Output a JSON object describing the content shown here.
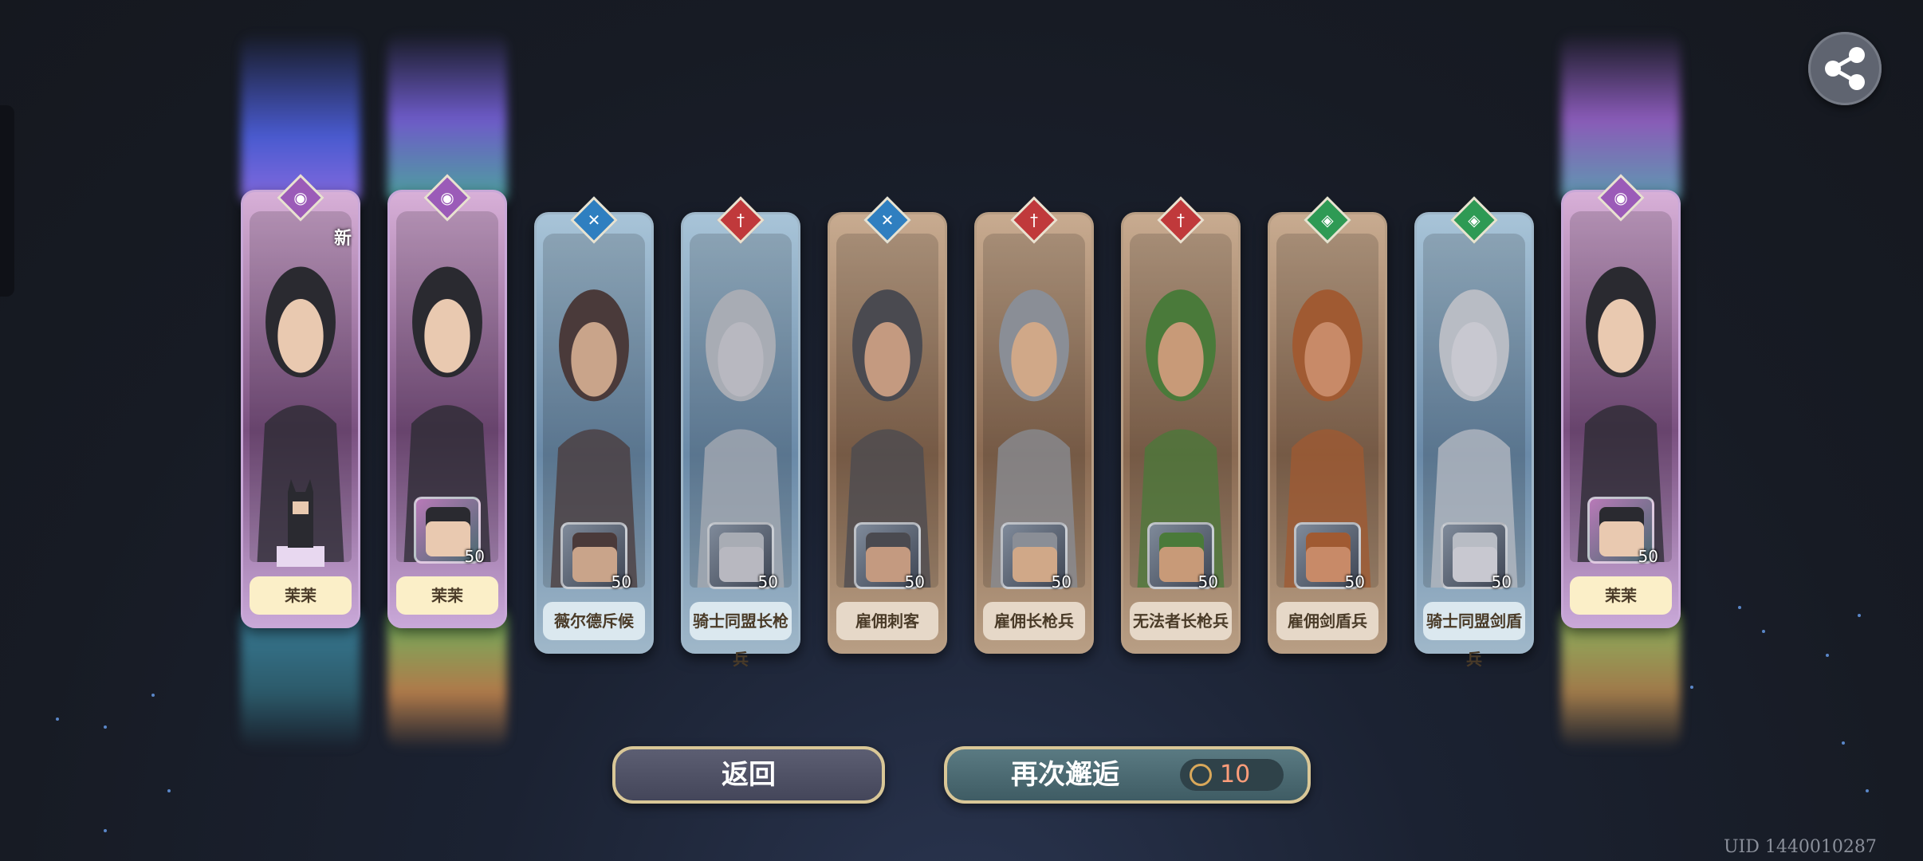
{
  "cards": [
    {
      "name": "茉茉",
      "rarity": "ssr",
      "badge_color": "#9b5bb8",
      "badge_icon": "vortex-icon",
      "frame_color": "#c9a8d8",
      "is_new": true,
      "new_label": "新",
      "reward": "sprite"
    },
    {
      "name": "茉茉",
      "rarity": "ssr",
      "badge_color": "#9b5bb8",
      "badge_icon": "vortex-icon",
      "frame_color": "#c9a8d8",
      "is_new": false,
      "reward_qty": "50"
    },
    {
      "name": "薇尔德斥候",
      "rarity": "sr",
      "badge_color": "#2f7fc0",
      "badge_icon": "crossed-swords-icon",
      "frame_color": "#9fb7c9",
      "reward_qty": "50"
    },
    {
      "name": "骑士同盟长枪兵",
      "rarity": "sr",
      "badge_color": "#c0393b",
      "badge_icon": "spear-icon",
      "frame_color": "#9fb7c9",
      "reward_qty": "50"
    },
    {
      "name": "雇佣刺客",
      "rarity": "r",
      "badge_color": "#2f7fc0",
      "badge_icon": "crossed-swords-icon",
      "frame_color": "#b89e84",
      "reward_qty": "50"
    },
    {
      "name": "雇佣长枪兵",
      "rarity": "r",
      "badge_color": "#c0393b",
      "badge_icon": "spear-icon",
      "frame_color": "#b89e84",
      "reward_qty": "50"
    },
    {
      "name": "无法者长枪兵",
      "rarity": "r",
      "badge_color": "#c0393b",
      "badge_icon": "spear-icon",
      "frame_color": "#b89e84",
      "reward_qty": "50"
    },
    {
      "name": "雇佣剑盾兵",
      "rarity": "r",
      "badge_color": "#2e9a54",
      "badge_icon": "shield-icon",
      "frame_color": "#b89e84",
      "reward_qty": "50"
    },
    {
      "name": "骑士同盟剑盾兵",
      "rarity": "sr",
      "badge_color": "#2e9a54",
      "badge_icon": "shield-icon",
      "frame_color": "#9fb7c9",
      "reward_qty": "50"
    },
    {
      "name": "茉茉",
      "rarity": "ssr",
      "badge_color": "#9b5bb8",
      "badge_icon": "vortex-icon",
      "frame_color": "#c9a8d8",
      "reward_qty": "50"
    }
  ],
  "buttons": {
    "back_label": "返回",
    "again_label": "再次邂逅",
    "again_cost": "10",
    "cost_icon": "summon-coin-icon"
  },
  "share_icon": "share-icon",
  "uid": "UID 1440010287",
  "colors": {
    "button_border": "#d9c797",
    "cost_text": "#ff9d7a"
  }
}
